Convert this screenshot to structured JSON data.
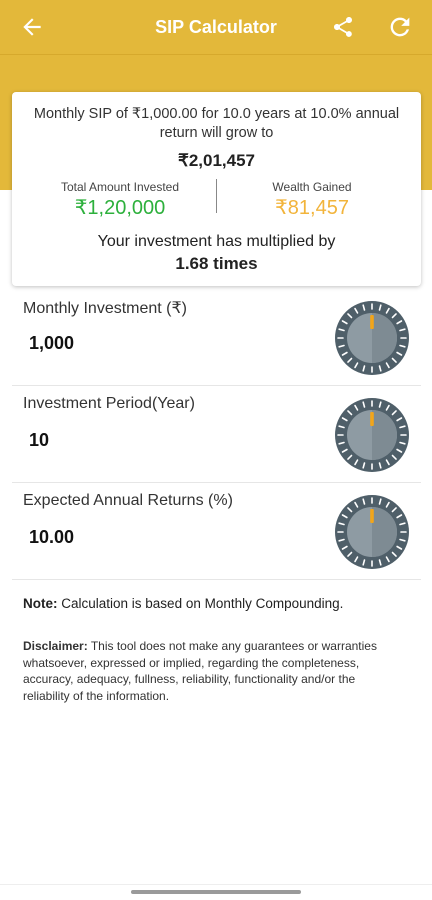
{
  "app_bar": {
    "title": "SIP Calculator",
    "icons": [
      "back-arrow-icon",
      "share-icon",
      "refresh-icon"
    ]
  },
  "result_card": {
    "summary": "Monthly SIP of ₹1,000.00 for 10.0 years at 10.0% annual return will grow to",
    "total_value": "₹2,01,457",
    "invested_label": "Total Amount Invested",
    "invested_value": "₹1,20,000",
    "gained_label": "Wealth Gained",
    "gained_value": "₹81,457",
    "multiplier_label": "Your investment has multiplied by",
    "multiplier_value": "1.68 times"
  },
  "inputs": [
    {
      "label": "Monthly Investment (₹)",
      "value": "1,000"
    },
    {
      "label": "Investment Period(Year)",
      "value": "10"
    },
    {
      "label": "Expected Annual Returns (%)",
      "value": "10.00"
    }
  ],
  "note": {
    "prefix": "Note:",
    "text": " Calculation is based on Monthly Compounding."
  },
  "disclaimer": {
    "prefix": "Disclaimer:",
    "text": " This tool does not make any guarantees or warranties whatsoever, expressed or implied, regarding the completeness, accuracy, adequacy, fullness, reliability, functionality and/or the reliability of the information."
  },
  "colors": {
    "brand": "#E3B83A",
    "invested": "#2DB03C",
    "gained": "#F2B43B",
    "knob": "#4F5F69",
    "knob_marker": "#F2A51A"
  }
}
